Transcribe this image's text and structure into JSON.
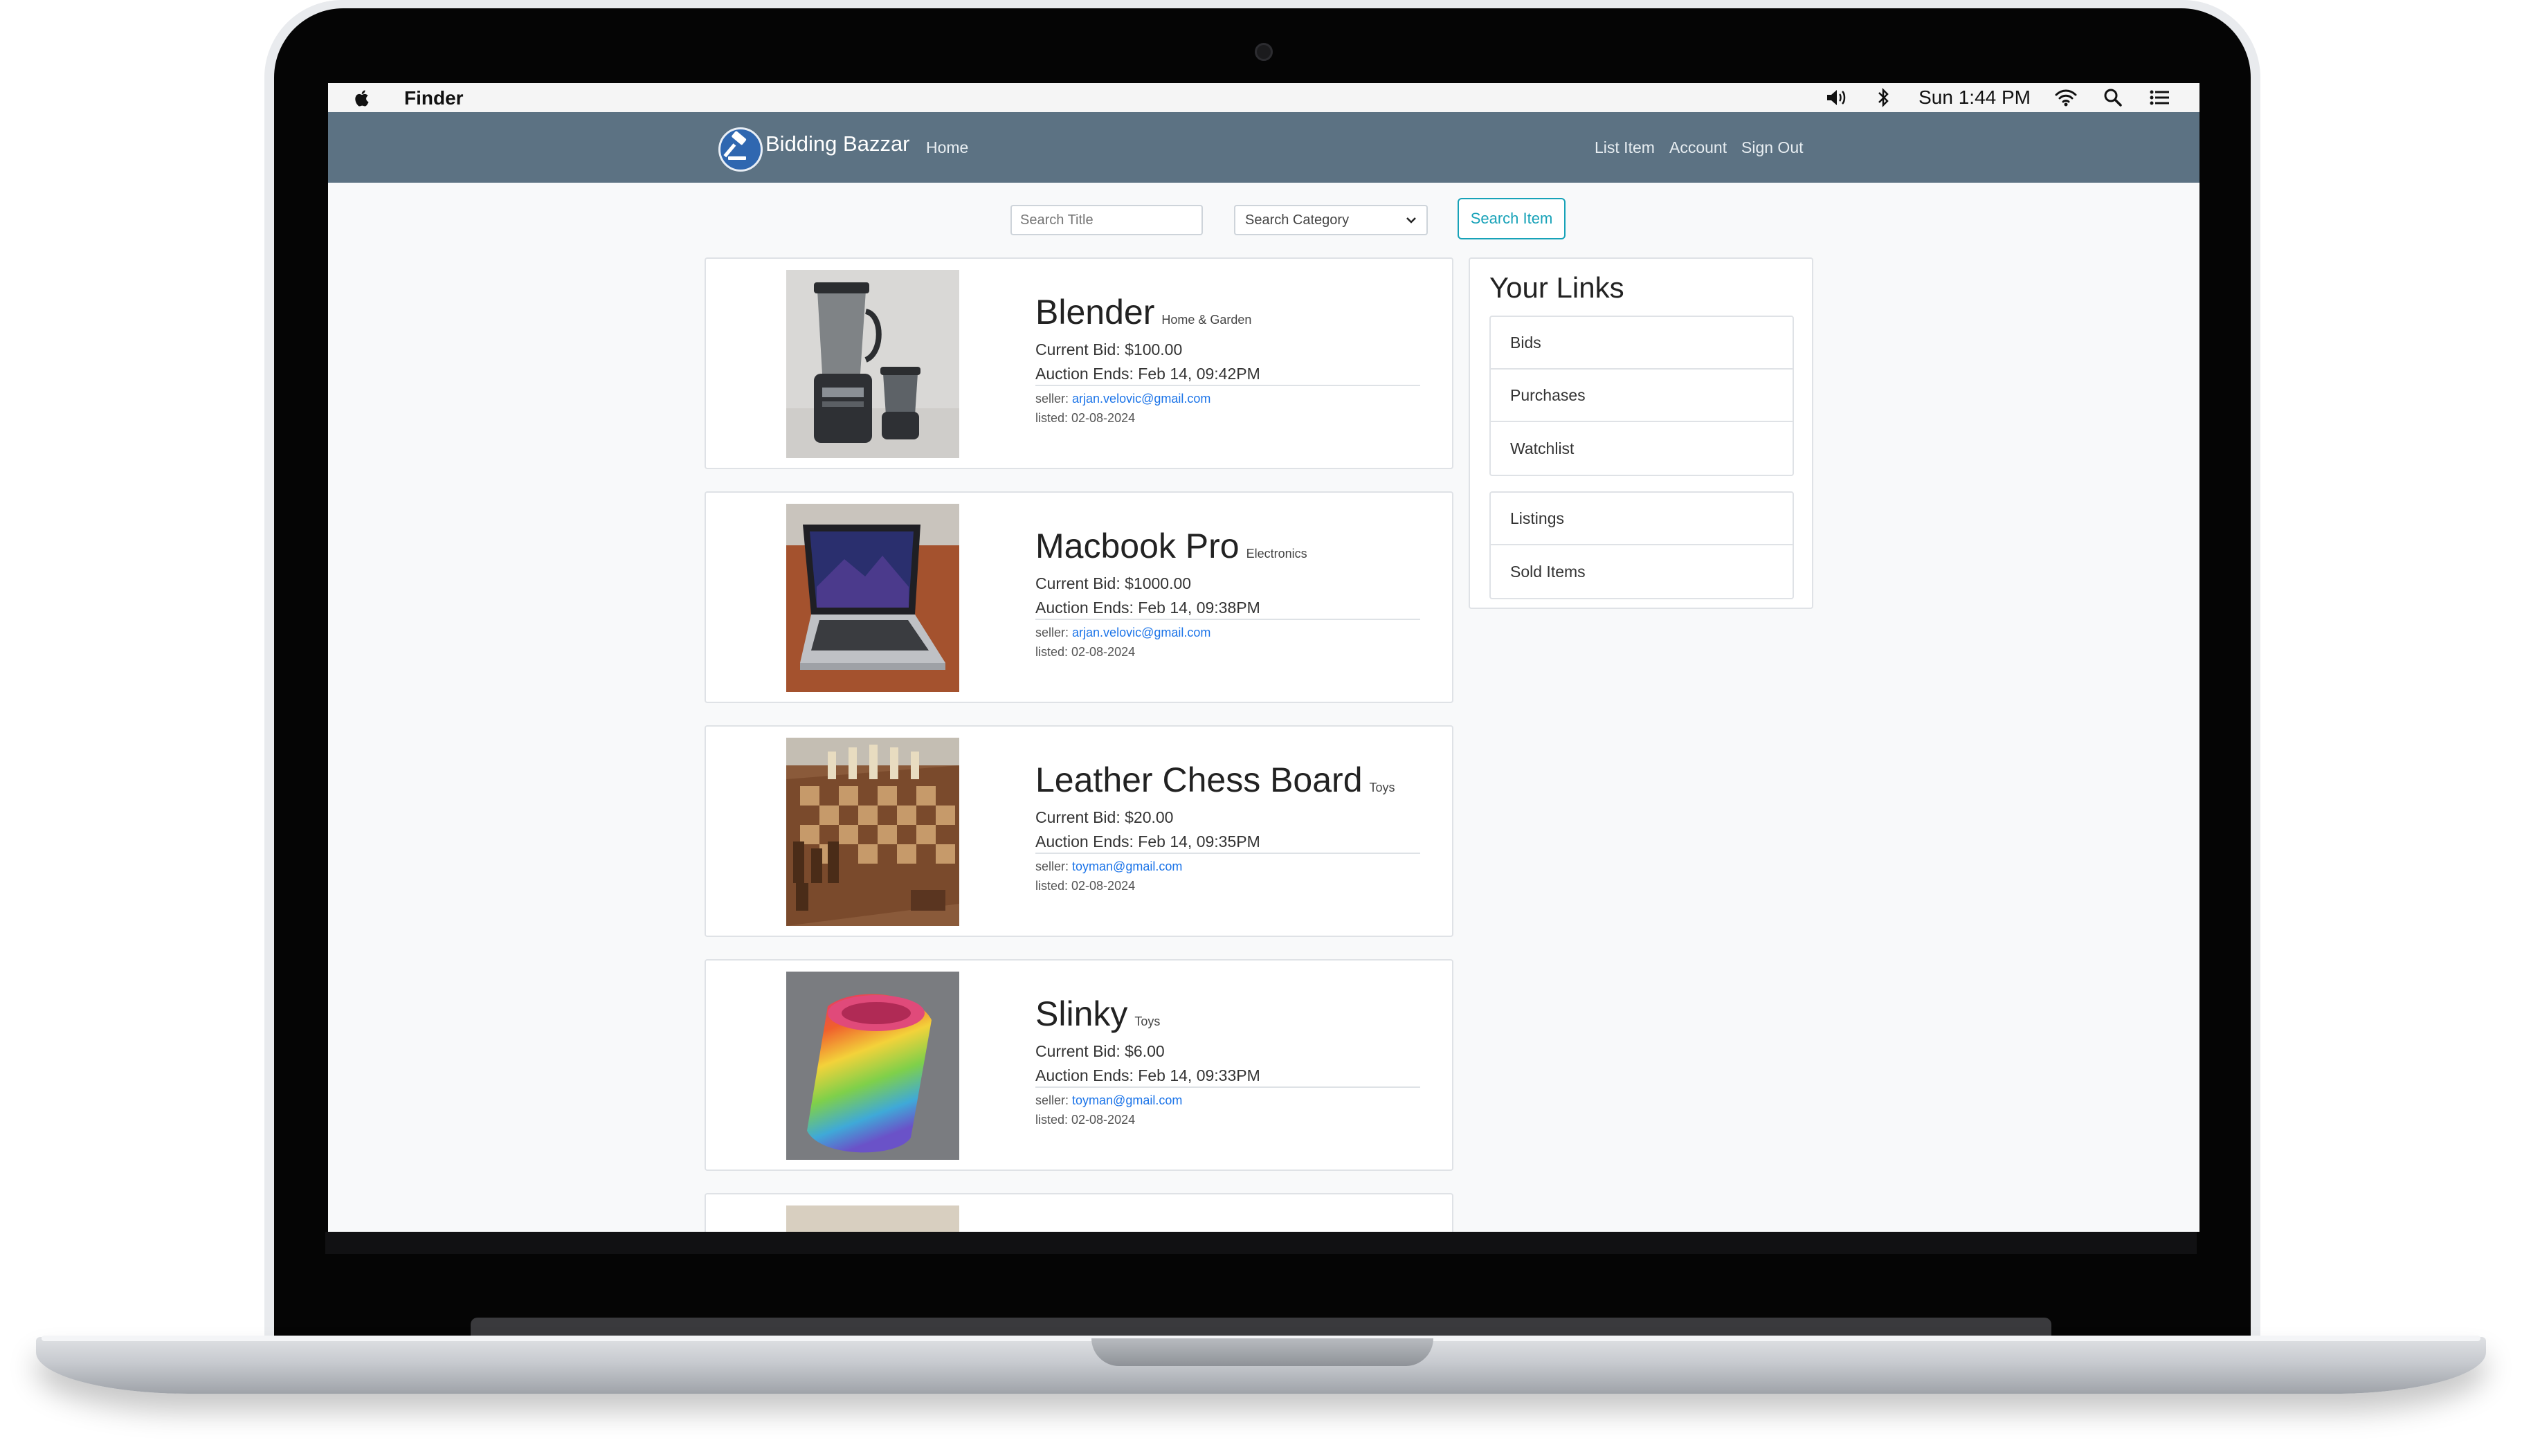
{
  "menubar": {
    "app_name": "Finder",
    "clock": "Sun 1:44 PM",
    "icons": [
      "apple-icon",
      "volume-icon",
      "bluetooth-icon",
      "wifi-icon",
      "spotlight-icon",
      "control-center-icon"
    ]
  },
  "navbar": {
    "brand": "Bidding Bazzar",
    "home": "Home",
    "list_item": "List Item",
    "account": "Account",
    "sign_out": "Sign Out",
    "background": "#5c7283"
  },
  "search": {
    "title_placeholder": "Search Title",
    "category_value": "Search Category",
    "button": "Search Item",
    "button_color": "#17a2b8"
  },
  "listings": [
    {
      "title": "Blender",
      "category": "Home & Garden",
      "bid": "Current Bid: $100.00",
      "ends": "Auction Ends: Feb 14, 09:42PM",
      "seller_label": "seller:",
      "seller": "arjan.velovic@gmail.com",
      "listed": "listed: 02-08-2024"
    },
    {
      "title": "Macbook Pro",
      "category": "Electronics",
      "bid": "Current Bid: $1000.00",
      "ends": "Auction Ends: Feb 14, 09:38PM",
      "seller_label": "seller:",
      "seller": "arjan.velovic@gmail.com",
      "listed": "listed: 02-08-2024"
    },
    {
      "title": "Leather Chess Board",
      "category": "Toys",
      "bid": "Current Bid: $20.00",
      "ends": "Auction Ends: Feb 14, 09:35PM",
      "seller_label": "seller:",
      "seller": "toyman@gmail.com",
      "listed": "listed: 02-08-2024"
    },
    {
      "title": "Slinky",
      "category": "Toys",
      "bid": "Current Bid: $6.00",
      "ends": "Auction Ends: Feb 14, 09:33PM",
      "seller_label": "seller:",
      "seller": "toyman@gmail.com",
      "listed": "listed: 02-08-2024"
    }
  ],
  "sidebar": {
    "title": "Your Links",
    "group1": [
      "Bids",
      "Purchases",
      "Watchlist"
    ],
    "group2": [
      "Listings",
      "Sold Items"
    ]
  }
}
